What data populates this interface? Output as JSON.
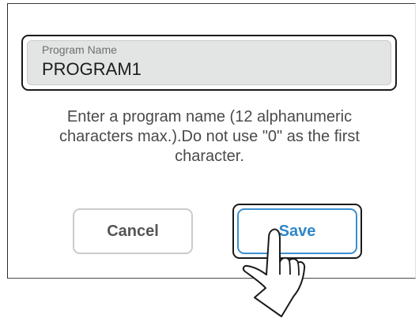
{
  "dialog": {
    "name_field": {
      "label": "Program Name",
      "value": "PROGRAM1"
    },
    "instructions": "Enter a program name (12 alphanumeric characters max.).Do not use \"0\" as the first character.",
    "buttons": {
      "cancel_label": "Cancel",
      "save_label": "Save"
    },
    "accent_color": "#2f86c8",
    "pointer_icon": "pointing-hand-icon"
  }
}
